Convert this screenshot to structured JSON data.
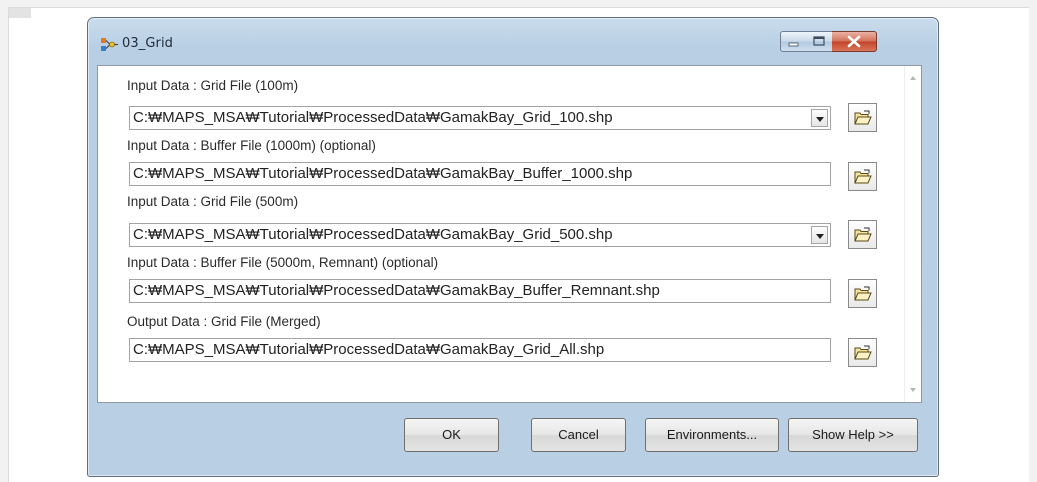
{
  "window": {
    "title": "03_Grid"
  },
  "fields": [
    {
      "label": "Input Data : Grid File (100m)",
      "value": "C:₩MAPS_MSA₩Tutorial₩ProcessedData₩GamakBay_Grid_100.shp",
      "type": "combo"
    },
    {
      "label": "Input Data : Buffer File (1000m) (optional)",
      "value": "C:₩MAPS_MSA₩Tutorial₩ProcessedData₩GamakBay_Buffer_1000.shp",
      "type": "text"
    },
    {
      "label": "Input Data : Grid File (500m)",
      "value": "C:₩MAPS_MSA₩Tutorial₩ProcessedData₩GamakBay_Grid_500.shp",
      "type": "combo"
    },
    {
      "label": "Input Data : Buffer File (5000m, Remnant) (optional)",
      "value": "C:₩MAPS_MSA₩Tutorial₩ProcessedData₩GamakBay_Buffer_Remnant.shp",
      "type": "text"
    },
    {
      "label": "Output Data : Grid File (Merged)",
      "value": "C:₩MAPS_MSA₩Tutorial₩ProcessedData₩GamakBay_Grid_All.shp",
      "type": "text"
    }
  ],
  "buttons": {
    "ok": "OK",
    "cancel": "Cancel",
    "environments": "Environments...",
    "help": "Show Help >>"
  },
  "icons": {
    "title": "model-tool-icon",
    "browse": "open-folder-icon"
  }
}
